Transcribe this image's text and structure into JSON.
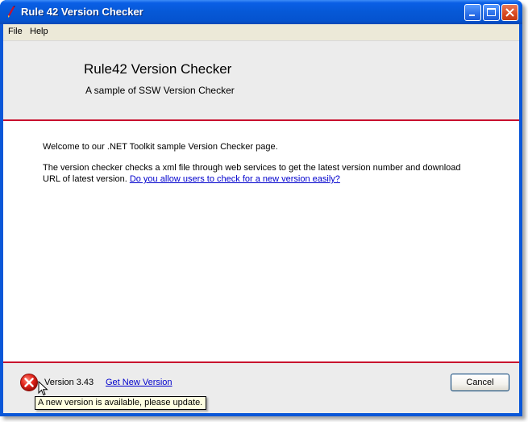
{
  "window": {
    "title": "Rule 42 Version Checker"
  },
  "menu": {
    "items": [
      "File",
      "Help"
    ]
  },
  "header": {
    "title": "Rule42 Version Checker",
    "subtitle": "A sample of SSW Version Checker"
  },
  "content": {
    "welcome": "Welcome to our .NET Toolkit sample Version Checker page.",
    "description": "The version checker checks a xml file through web services to get the latest version number and download URL of latest version.",
    "link": "Do you allow users to check for a new version easily?"
  },
  "footer": {
    "version": "Version 3.43",
    "get_new_version": "Get New Version",
    "cancel": "Cancel",
    "status_icon": "error-icon"
  },
  "tooltip": {
    "text": "A new version is available, please update."
  },
  "colors": {
    "accent_line": "#c8102e",
    "titlebar": "#0658d6",
    "link": "#0000cc"
  }
}
